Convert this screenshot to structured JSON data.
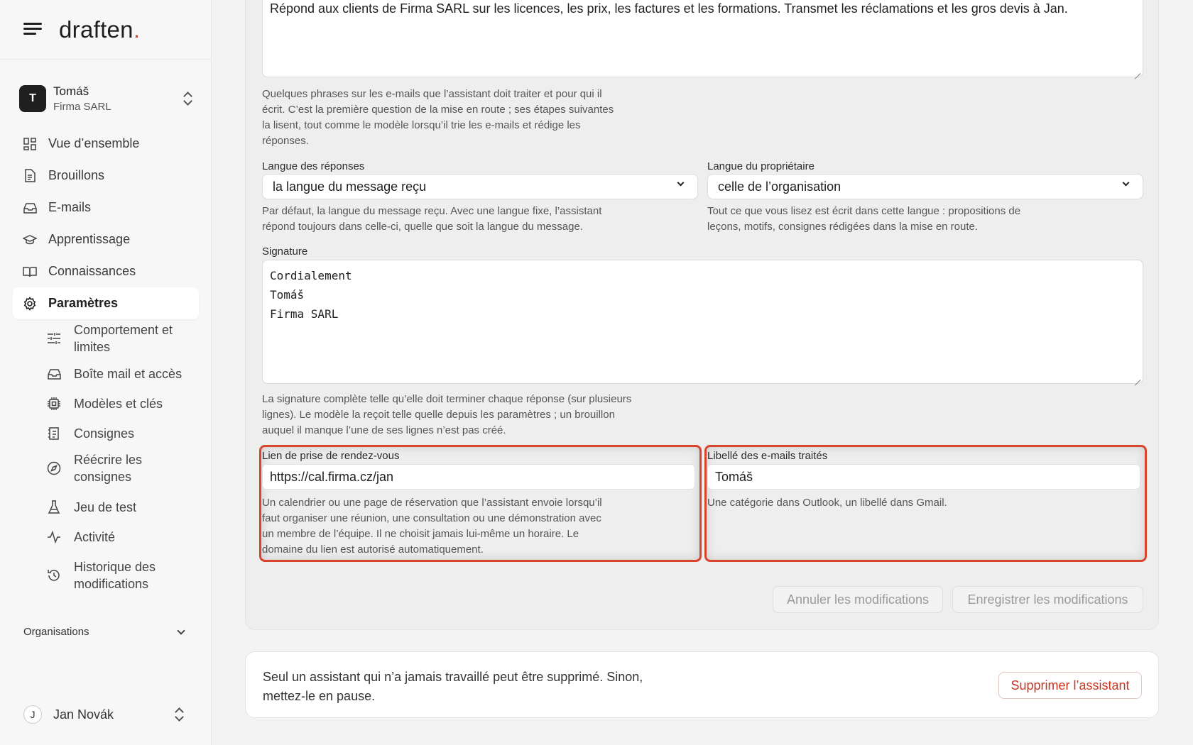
{
  "brand": {
    "name": "draften",
    "dot": "."
  },
  "account": {
    "initial": "T",
    "name": "Tomáš",
    "org": "Firma SARL"
  },
  "nav": [
    {
      "label": "Vue d’ensemble",
      "icon": "dashboard-icon"
    },
    {
      "label": "Brouillons",
      "icon": "document-icon"
    },
    {
      "label": "E-mails",
      "icon": "inbox-icon"
    },
    {
      "label": "Apprentissage",
      "icon": "graduation-cap-icon"
    },
    {
      "label": "Connaissances",
      "icon": "book-icon"
    },
    {
      "label": "Paramètres",
      "icon": "gear-icon",
      "active": true
    }
  ],
  "subnav": [
    {
      "label": "Comportement et limites",
      "icon": "sliders-icon"
    },
    {
      "label": "Boîte mail et accès",
      "icon": "inbox-icon"
    },
    {
      "label": "Modèles et clés",
      "icon": "chip-icon"
    },
    {
      "label": "Consignes",
      "icon": "list-icon"
    },
    {
      "label": "Réécrire les consignes",
      "icon": "compass-icon"
    },
    {
      "label": "Jeu de test",
      "icon": "flask-icon"
    },
    {
      "label": "Activité",
      "icon": "activity-icon"
    },
    {
      "label": "Historique des modifications",
      "icon": "history-icon"
    }
  ],
  "organisations": {
    "label": "Organisations"
  },
  "user": {
    "initial": "J",
    "name": "Jan Novák"
  },
  "form": {
    "description": {
      "value": "Répond aux clients de Firma SARL sur les licences, les prix, les factures et les formations. Transmet les réclamations et les gros devis à Jan.",
      "help": "Quelques phrases sur les e-mails que l’assistant doit traiter et pour qui il écrit. C’est la première question de la mise en route ; ses étapes suivantes la lisent, tout comme le modèle lorsqu’il trie les e-mails et rédige les réponses."
    },
    "reply_language": {
      "label": "Langue des réponses",
      "value": "la langue du message reçu",
      "help": "Par défaut, la langue du message reçu. Avec une langue fixe, l’assistant répond toujours dans celle-ci, quelle que soit la langue du message."
    },
    "owner_language": {
      "label": "Langue du propriétaire",
      "value": "celle de l’organisation",
      "help": "Tout ce que vous lisez est écrit dans cette langue : propositions de leçons, motifs, consignes rédigées dans la mise en route."
    },
    "signature": {
      "label": "Signature",
      "lines": [
        "Cordialement",
        "Tomáš",
        "Firma SARL"
      ],
      "help": "La signature complète telle qu’elle doit terminer chaque réponse (sur plusieurs lignes). Le modèle la reçoit telle quelle depuis les paramètres ; un brouillon auquel il manque l’une de ses lignes n’est pas créé."
    },
    "booking_link": {
      "label": "Lien de prise de rendez-vous",
      "value": "https://cal.firma.cz/jan",
      "help": "Un calendrier ou une page de réservation que l’assistant envoie lorsqu’il faut organiser une réunion, une consultation ou une démonstration avec un membre de l’équipe. Il ne choisit jamais lui-même un horaire. Le domaine du lien est autorisé automatiquement."
    },
    "processed_label": {
      "label": "Libellé des e-mails traités",
      "value": "Tomáš",
      "help": "Une catégorie dans Outlook, un libellé dans Gmail."
    },
    "cancel_label": "Annuler les modifications",
    "save_label": "Enregistrer les modifications"
  },
  "danger": {
    "message": "Seul un assistant qui n’a jamais travaillé peut être supprimé. Sinon, mettez-le en pause.",
    "button": "Supprimer l’assistant"
  },
  "colors": {
    "accent": "#d9442e",
    "danger": "#c9341f",
    "text": "#1f1f1f"
  }
}
